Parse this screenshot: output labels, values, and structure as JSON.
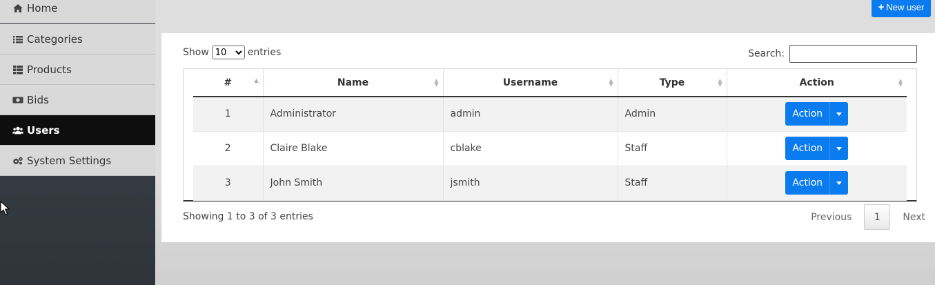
{
  "sidebar": {
    "items": [
      {
        "label": "Home",
        "icon": "home-icon"
      },
      {
        "label": "Categories",
        "icon": "list-icon"
      },
      {
        "label": "Products",
        "icon": "th-list-icon"
      },
      {
        "label": "Bids",
        "icon": "money-icon"
      },
      {
        "label": "Users",
        "icon": "users-icon",
        "active": true
      },
      {
        "label": "System Settings",
        "icon": "cogs-icon"
      }
    ]
  },
  "header": {
    "new_user_label": "New user"
  },
  "table_controls": {
    "show_label": "Show",
    "entries_label": "entries",
    "page_length": "10",
    "search_label": "Search:",
    "search_value": ""
  },
  "table": {
    "columns": [
      "#",
      "Name",
      "Username",
      "Type",
      "Action"
    ],
    "rows": [
      {
        "num": "1",
        "name": "Administrator",
        "username": "admin",
        "type": "Admin",
        "action": "Action"
      },
      {
        "num": "2",
        "name": "Claire Blake",
        "username": "cblake",
        "type": "Staff",
        "action": "Action"
      },
      {
        "num": "3",
        "name": "John Smith",
        "username": "jsmith",
        "type": "Staff",
        "action": "Action"
      }
    ]
  },
  "footer": {
    "info": "Showing 1 to 3 of 3 entries",
    "previous": "Previous",
    "current_page": "1",
    "next": "Next"
  },
  "colors": {
    "primary": "#0b7cf0",
    "sidebar_active": "#0e0e0e",
    "sidebar_item": "#d9d9d9"
  }
}
